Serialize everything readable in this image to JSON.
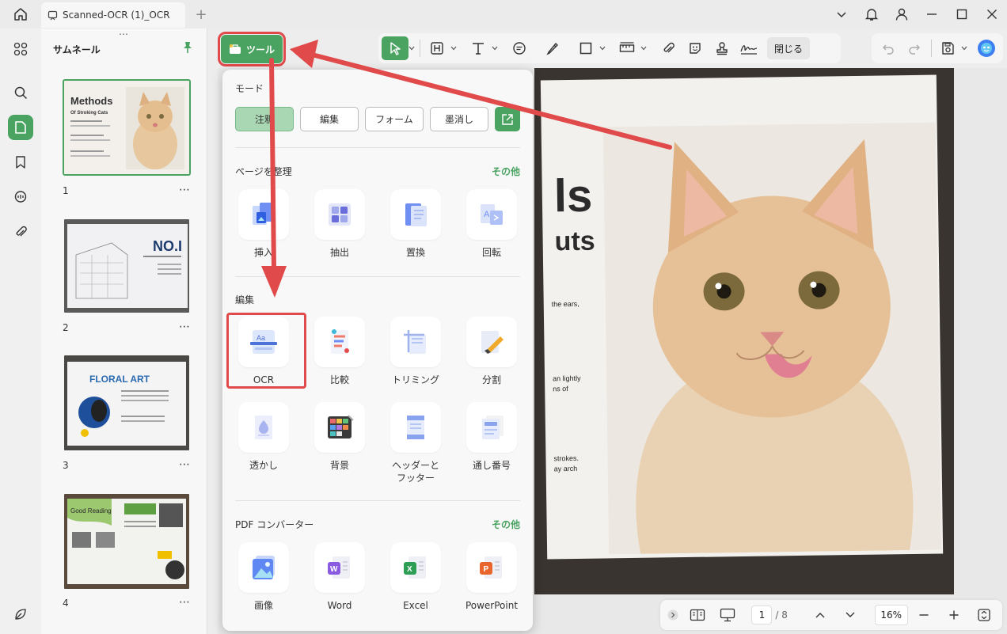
{
  "tab": {
    "title": "Scanned-OCR (1)_OCR"
  },
  "sidebar": {
    "title": "サムネール",
    "pages": [
      {
        "number": "1",
        "thumb_title": "Methods",
        "thumb_sub": "Of Stroking Cats"
      },
      {
        "number": "2",
        "thumb_title": "NO.I",
        "thumb_sub": ""
      },
      {
        "number": "3",
        "thumb_title": "FLORAL ART",
        "thumb_sub": ""
      },
      {
        "number": "4",
        "thumb_title": "Good Reading",
        "thumb_sub": ""
      }
    ],
    "more": "⋯"
  },
  "toolbar": {
    "tools_label": "ツール",
    "close_label": "閉じる"
  },
  "popup": {
    "mode_title": "モード",
    "modes": [
      "注釈",
      "編集",
      "フォーム",
      "墨消し"
    ],
    "manage_title": "ページを整理",
    "more_label": "その他",
    "manage_tools": [
      "挿入",
      "抽出",
      "置換",
      "回転"
    ],
    "edit_title": "編集",
    "edit_tools": [
      "OCR",
      "比較",
      "トリミング",
      "分割",
      "透かし",
      "背景",
      "ヘッダーと\nフッター",
      "通し番号"
    ],
    "converter_title": "PDF コンバーター",
    "converter_tools": [
      "画像",
      "Word",
      "Excel",
      "PowerPoint"
    ]
  },
  "document": {
    "heading_fragment_1": "ls",
    "heading_fragment_2": "uts",
    "body_fragments": [
      "the ears,",
      "an lightly",
      "ns of",
      "strokes.",
      "ay arch"
    ]
  },
  "status": {
    "page_current": "1",
    "page_total": "/ 8",
    "zoom": "16%"
  },
  "colors": {
    "accent": "#4aa361",
    "annotation": "#e04a4a"
  }
}
